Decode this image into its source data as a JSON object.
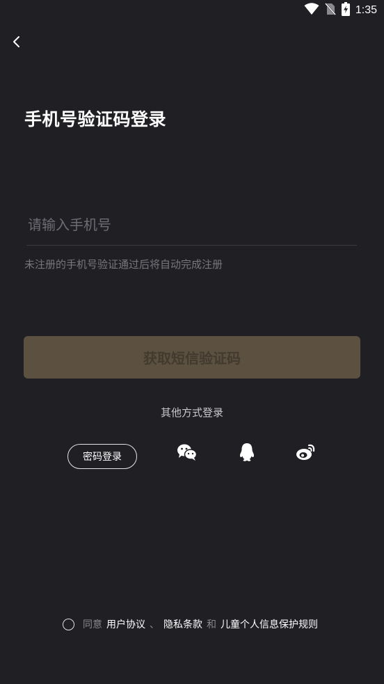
{
  "status_bar": {
    "time": "1:35"
  },
  "header": {
    "title": "手机号验证码登录"
  },
  "phone_input": {
    "value": "",
    "placeholder": "请输入手机号"
  },
  "hint": "未注册的手机号验证通过后将自动完成注册",
  "sms_button_label": "获取短信验证码",
  "other_login": {
    "label": "其他方式登录",
    "password_login_label": "密码登录",
    "providers": [
      "wechat-icon",
      "qq-icon",
      "weibo-icon"
    ]
  },
  "agreement": {
    "agree": "同意",
    "user_agreement": "用户协议",
    "separator": "、",
    "privacy_terms": "隐私条款",
    "and": "和",
    "child_privacy": "儿童个人信息保护规则"
  },
  "colors": {
    "background": "#1f1f24",
    "button_disabled_bg": "#5c5140",
    "button_disabled_text": "#433a2f"
  }
}
